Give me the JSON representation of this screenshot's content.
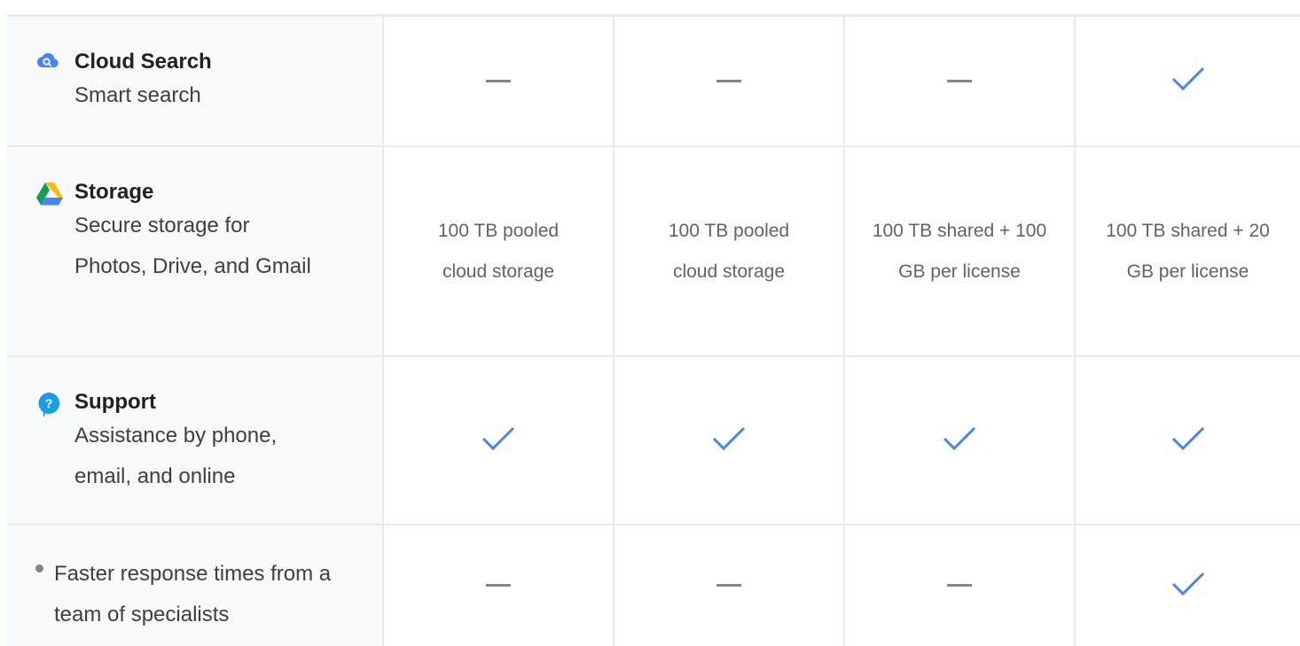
{
  "colors": {
    "accent_check": "#4285f4",
    "dash": "#80868b",
    "border": "#e8eaed",
    "feature_bg": "#f8f9fa"
  },
  "rows": [
    {
      "icon": "cloud-search-icon",
      "title": "Cloud Search",
      "description": "Smart search",
      "cells": [
        {
          "type": "dash"
        },
        {
          "type": "dash"
        },
        {
          "type": "dash"
        },
        {
          "type": "check"
        }
      ]
    },
    {
      "icon": "google-drive-icon",
      "title": "Storage",
      "description": "Secure storage for Photos, Drive, and Gmail",
      "cells": [
        {
          "type": "text",
          "text": "100 TB pooled cloud storage"
        },
        {
          "type": "text",
          "text": "100 TB pooled cloud storage"
        },
        {
          "type": "text",
          "text": "100 TB shared + 100 GB per license"
        },
        {
          "type": "text",
          "text": "100 TB shared + 20 GB per license"
        }
      ]
    },
    {
      "icon": "support-help-icon",
      "title": "Support",
      "description": "Assistance by phone, email, and online",
      "cells": [
        {
          "type": "check"
        },
        {
          "type": "check"
        },
        {
          "type": "check"
        },
        {
          "type": "check"
        }
      ]
    },
    {
      "icon": "bullet-icon",
      "subfeature": "Faster response times from a team of specialists",
      "cells": [
        {
          "type": "dash"
        },
        {
          "type": "dash"
        },
        {
          "type": "dash"
        },
        {
          "type": "check"
        }
      ]
    }
  ]
}
